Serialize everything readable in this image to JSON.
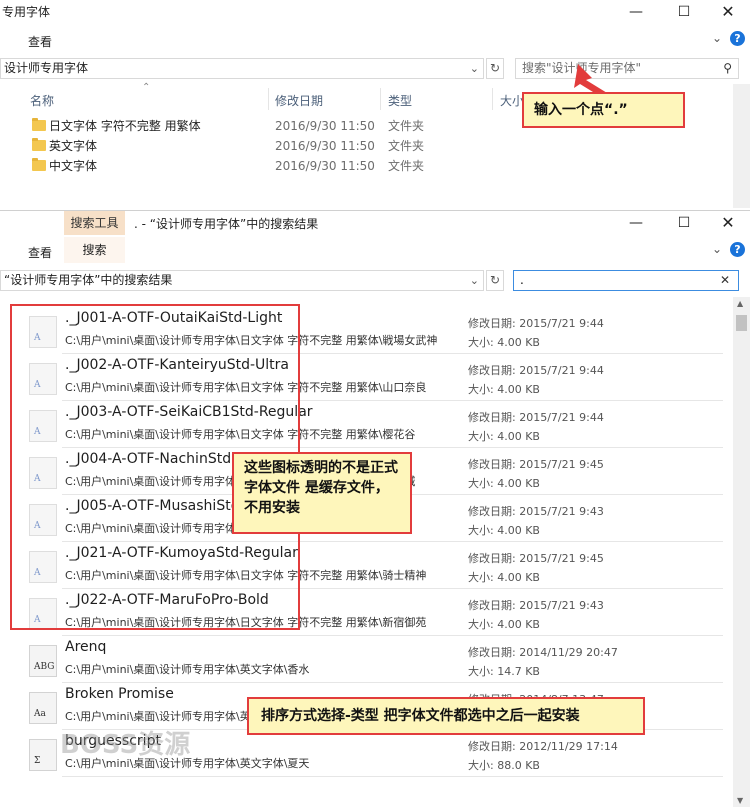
{
  "top": {
    "title": "专用字体",
    "ribbon_tab": "查看",
    "address": "设计师专用字体",
    "search_placeholder": "搜索\"设计师专用字体\"",
    "columns": {
      "name": "名称",
      "date": "修改日期",
      "type": "类型",
      "size": "大小"
    },
    "rows": [
      {
        "name": "日文字体 字符不完整 用繁体",
        "date": "2016/9/30 11:50",
        "type": "文件夹"
      },
      {
        "name": "英文字体",
        "date": "2016/9/30 11:50",
        "type": "文件夹"
      },
      {
        "name": "中文字体",
        "date": "2016/9/30 11:50",
        "type": "文件夹"
      }
    ]
  },
  "bottom": {
    "context_tab": "搜索工具",
    "title": ". - “设计师专用字体”中的搜索结果",
    "ribbon_tabs": [
      "查看",
      "搜索"
    ],
    "address": "“设计师专用字体”中的搜索结果",
    "search_value": ".",
    "date_label": "修改日期:",
    "size_label": "大小:",
    "results": [
      {
        "name": "._J001-A-OTF-OutaiKaiStd-Light",
        "path": "C:\\用户\\mini\\桌面\\设计师专用字体\\日文字体 字符不完整 用繁体\\戦場女武神",
        "date": "2015/7/21 9:44",
        "size": "4.00 KB",
        "icon": "A"
      },
      {
        "name": "._J002-A-OTF-KanteiryuStd-Ultra",
        "path": "C:\\用户\\mini\\桌面\\设计师专用字体\\日文字体 字符不完整 用繁体\\山口奈良",
        "date": "2015/7/21 9:44",
        "size": "4.00 KB",
        "icon": "A"
      },
      {
        "name": "._J003-A-OTF-SeiKaiCB1Std-Regular",
        "path": "C:\\用户\\mini\\桌面\\设计师专用字体\\日文字体 字符不完整 用繁体\\樱花谷",
        "date": "2015/7/21 9:44",
        "size": "4.00 KB",
        "icon": "A"
      },
      {
        "name": "._J004-A-OTF-NachinStd",
        "path": "C:\\用户\\mini\\桌面\\设计师专用字体\\日文字体 字符不完整 用繁体\\灵魂城",
        "date": "2015/7/21 9:45",
        "size": "4.00 KB",
        "icon": "A"
      },
      {
        "name": "._J005-A-OTF-MusashiStd",
        "path": "C:\\用户\\mini\\桌面\\设计师专用字体\\日文字体 字符不完整 用繁体\\天国",
        "date": "2015/7/21 9:43",
        "size": "4.00 KB",
        "icon": "A"
      },
      {
        "name": "._J021-A-OTF-KumoyaStd-Regular",
        "path": "C:\\用户\\mini\\桌面\\设计师专用字体\\日文字体 字符不完整 用繁体\\骑士精神",
        "date": "2015/7/21 9:45",
        "size": "4.00 KB",
        "icon": "A"
      },
      {
        "name": "._J022-A-OTF-MaruFoPro-Bold",
        "path": "C:\\用户\\mini\\桌面\\设计师专用字体\\日文字体 字符不完整 用繁体\\新宿御苑",
        "date": "2015/7/21 9:43",
        "size": "4.00 KB",
        "icon": "A"
      },
      {
        "name": "Arenq",
        "path": "C:\\用户\\mini\\桌面\\设计师专用字体\\英文字体\\香水",
        "date": "2014/11/29 20:47",
        "size": "14.7 KB",
        "icon": "ABG"
      },
      {
        "name": "Broken Promise",
        "path": "C:\\用户\\mini\\桌面\\设计师专用字体\\英文字体",
        "date": "2014/8/7 13:47",
        "size": "",
        "icon": "Aa"
      },
      {
        "name": "burguesscript",
        "path": "C:\\用户\\mini\\桌面\\设计师专用字体\\英文字体\\夏天",
        "date": "2012/11/29 17:14",
        "size": "88.0 KB",
        "icon": "Σ"
      }
    ]
  },
  "callouts": {
    "dot": "输入一个点“.”",
    "transparent": "这些图标透明的不是正式字体文件 是缓存文件，不用安装",
    "sort": "排序方式选择-类型  把字体文件都选中之后一起安装"
  },
  "watermark": "BOSS资源",
  "colors": {
    "callout_bg": "#fef6bb",
    "callout_border": "#e23c3c",
    "selection_red": "#e23c3c",
    "context_tab": "#f7e0c8"
  }
}
